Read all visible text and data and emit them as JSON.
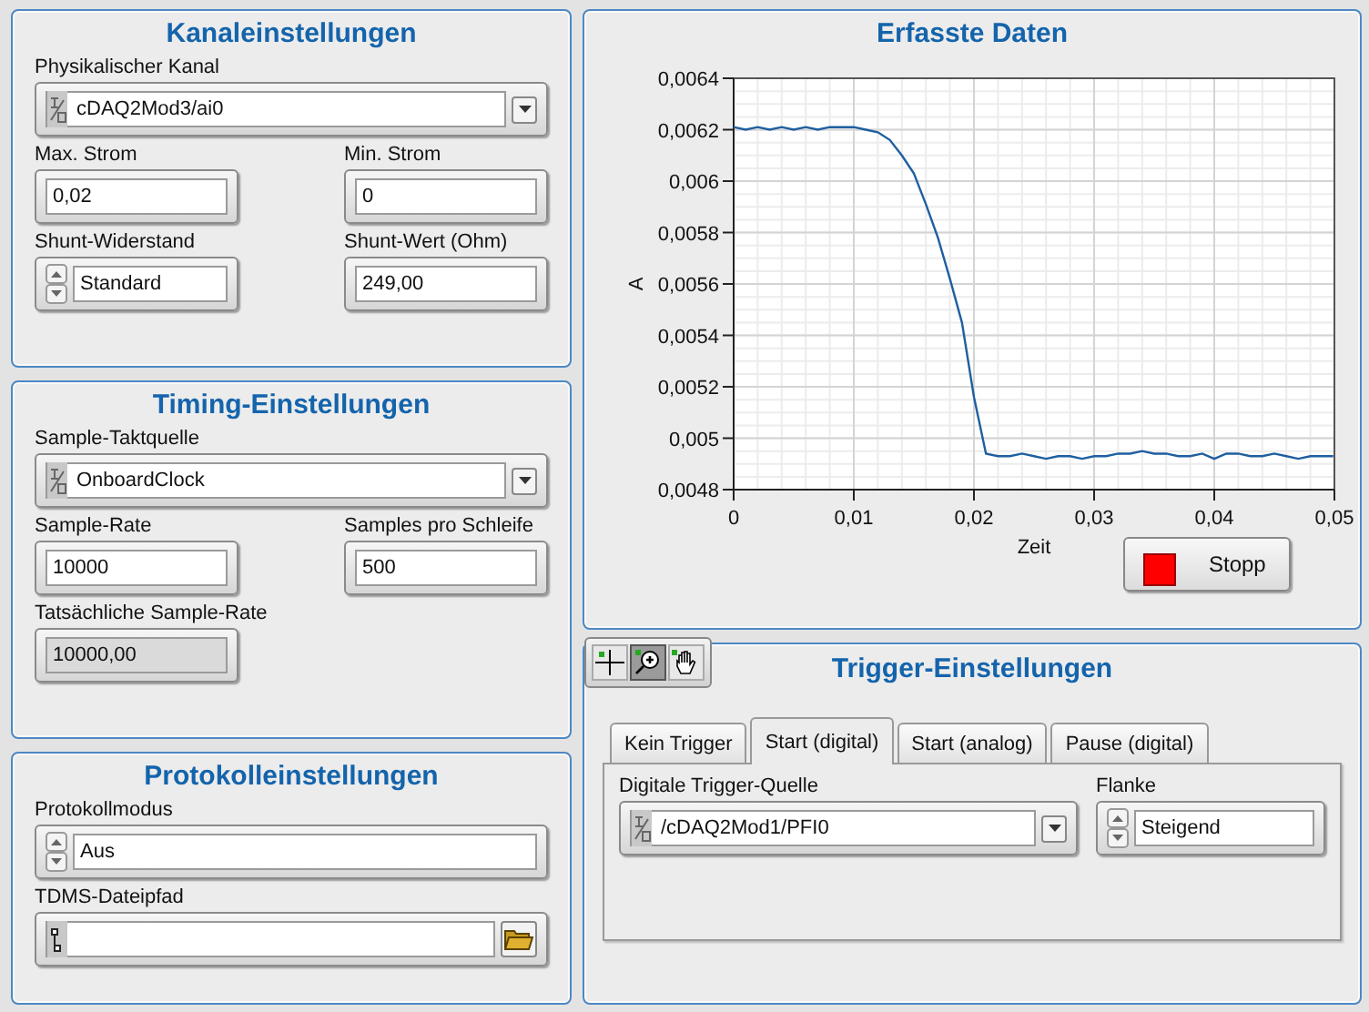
{
  "channel_settings": {
    "title": "Kanaleinstellungen",
    "rows": [
      [
        {
          "kind": "combo",
          "label": "Physikalischer Kanal",
          "value": "cDAQ2Mod3/ai0"
        }
      ],
      [
        {
          "kind": "numeric",
          "label": "Max. Strom",
          "value": "0,02"
        },
        {
          "kind": "numeric",
          "label": "Min. Strom",
          "value": "0"
        }
      ],
      [
        {
          "kind": "ring",
          "label": "Shunt-Widerstand",
          "value": "Standard"
        },
        {
          "kind": "numeric",
          "label": "Shunt-Wert (Ohm)",
          "value": "249,00"
        }
      ]
    ]
  },
  "timing_settings": {
    "title": "Timing-Einstellungen",
    "rows": [
      [
        {
          "kind": "combo",
          "label": "Sample-Taktquelle",
          "value": "OnboardClock"
        }
      ],
      [
        {
          "kind": "numeric",
          "label": "Sample-Rate",
          "value": "10000"
        },
        {
          "kind": "numeric",
          "label": "Samples pro Schleife",
          "value": "500"
        }
      ],
      [
        {
          "kind": "indicator",
          "label": "Tatsächliche Sample-Rate",
          "value": "10000,00"
        }
      ]
    ]
  },
  "logging_settings": {
    "title": "Protokolleinstellungen",
    "rows": [
      [
        {
          "kind": "ring",
          "label": "Protokollmodus",
          "value": "Aus"
        }
      ],
      [
        {
          "kind": "path",
          "label": "TDMS-Dateipfad"
        }
      ]
    ]
  },
  "acquired_data": {
    "title": "Erfasste Daten",
    "stop_button": "Stopp",
    "chart_data": {
      "type": "line",
      "xlabel": "Zeit",
      "ylabel": "A",
      "x": [
        0,
        0.001,
        0.002,
        0.003,
        0.004,
        0.005,
        0.006,
        0.007,
        0.008,
        0.009,
        0.01,
        0.011,
        0.012,
        0.013,
        0.014,
        0.015,
        0.016,
        0.017,
        0.018,
        0.019,
        0.02,
        0.021,
        0.022,
        0.023,
        0.024,
        0.025,
        0.026,
        0.027,
        0.028,
        0.029,
        0.03,
        0.031,
        0.032,
        0.033,
        0.034,
        0.035,
        0.036,
        0.037,
        0.038,
        0.039,
        0.04,
        0.041,
        0.042,
        0.043,
        0.044,
        0.045,
        0.046,
        0.047,
        0.048,
        0.049,
        0.0499
      ],
      "grid": true,
      "series": [
        {
          "color": "#1f5fa0",
          "values": [
            0.00621,
            0.0062,
            0.00621,
            0.0062,
            0.00621,
            0.0062,
            0.00621,
            0.0062,
            0.00621,
            0.00621,
            0.00621,
            0.0062,
            0.00619,
            0.00616,
            0.0061,
            0.00603,
            0.00591,
            0.00578,
            0.00562,
            0.00545,
            0.00516,
            0.00494,
            0.00493,
            0.00493,
            0.00494,
            0.00493,
            0.00492,
            0.00493,
            0.00493,
            0.00492,
            0.00493,
            0.00493,
            0.00494,
            0.00494,
            0.00495,
            0.00494,
            0.00494,
            0.00493,
            0.00493,
            0.00494,
            0.00492,
            0.00494,
            0.00494,
            0.00493,
            0.00493,
            0.00494,
            0.00493,
            0.00492,
            0.00493,
            0.00493,
            0.00493
          ]
        }
      ],
      "xlim": [
        0,
        0.05
      ],
      "ylim": [
        0.0048,
        0.0064
      ],
      "xticks": [
        {
          "value": 0,
          "label": "0"
        },
        {
          "value": 0.01,
          "label": "0,01"
        },
        {
          "value": 0.02,
          "label": "0,02"
        },
        {
          "value": 0.03,
          "label": "0,03"
        },
        {
          "value": 0.04,
          "label": "0,04"
        },
        {
          "value": 0.05,
          "label": "0,05"
        }
      ],
      "yticks": [
        {
          "value": 0.0048,
          "label": "0,0048"
        },
        {
          "value": 0.005,
          "label": "0,005"
        },
        {
          "value": 0.0052,
          "label": "0,0052"
        },
        {
          "value": 0.0054,
          "label": "0,0054"
        },
        {
          "value": 0.0056,
          "label": "0,0056"
        },
        {
          "value": 0.0058,
          "label": "0,0058"
        },
        {
          "value": 0.006,
          "label": "0,006"
        },
        {
          "value": 0.0062,
          "label": "0,0062"
        },
        {
          "value": 0.0064,
          "label": "0,0064"
        }
      ]
    }
  },
  "graph_palette": [
    {
      "kind": "cursor",
      "selected": false
    },
    {
      "kind": "zoom",
      "selected": true
    },
    {
      "kind": "pan",
      "selected": false
    }
  ],
  "trigger_settings": {
    "title": "Trigger-Einstellungen",
    "tabs": [
      {
        "label": "Kein Trigger",
        "selected": false
      },
      {
        "label": "Start (digital)",
        "selected": true
      },
      {
        "label": "Start (analog)",
        "selected": false
      },
      {
        "label": "Pause (digital)",
        "selected": false
      }
    ],
    "rows": [
      [
        {
          "kind": "combo",
          "label": "Digitale Trigger-Quelle",
          "value": "/cDAQ2Mod1/PFI0"
        },
        {
          "kind": "ring",
          "label": "Flanke",
          "value": "Steigend"
        }
      ]
    ]
  }
}
